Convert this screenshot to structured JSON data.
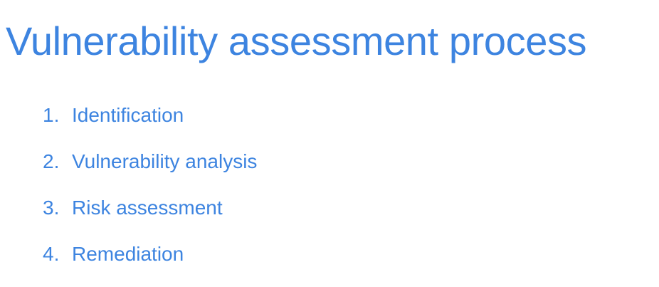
{
  "slide": {
    "title": "Vulnerability assessment process",
    "steps": [
      {
        "number": "1.",
        "label": "Identification"
      },
      {
        "number": "2.",
        "label": "Vulnerability analysis"
      },
      {
        "number": "3.",
        "label": "Risk assessment"
      },
      {
        "number": "4.",
        "label": "Remediation"
      }
    ]
  },
  "colors": {
    "text": "#3d84e0",
    "background": "#ffffff"
  }
}
